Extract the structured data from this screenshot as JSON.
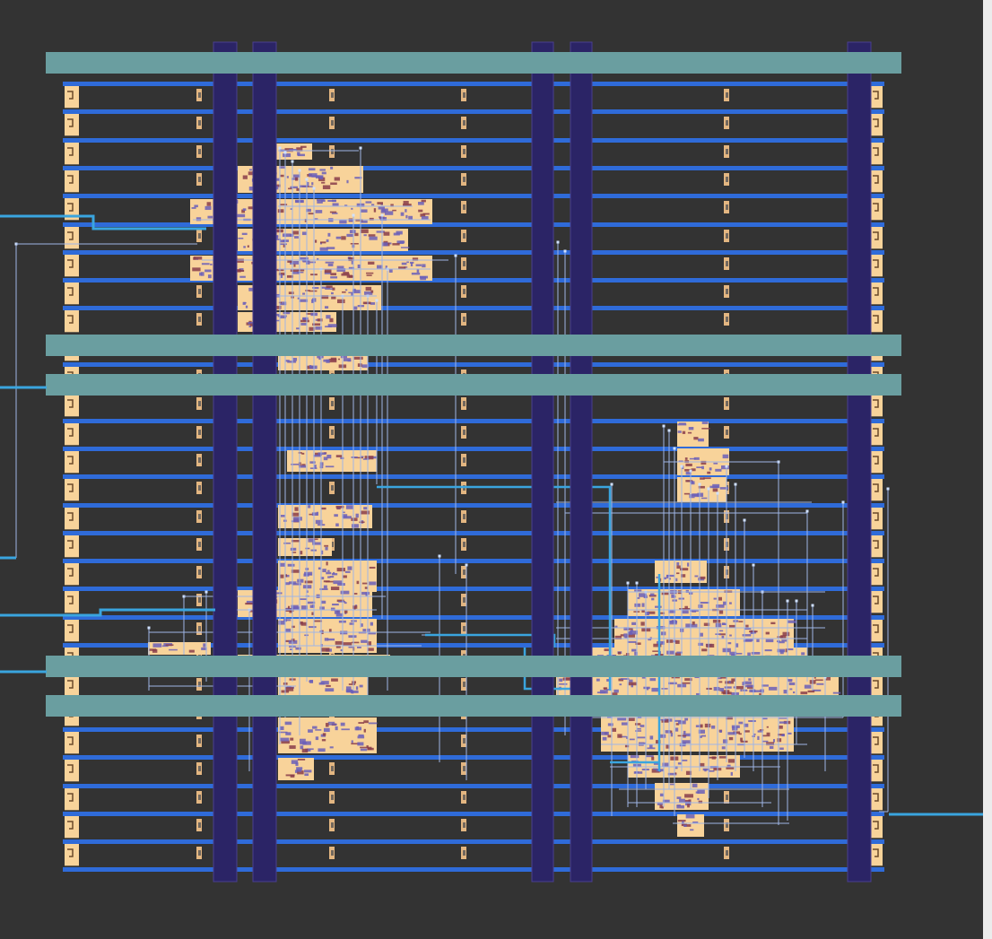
{
  "view": {
    "type": "chip-layout-viewer",
    "grid": "rows-and-columns"
  },
  "colors": {
    "background": "#333333",
    "scrollbar": "#ececec",
    "metal1_rail": "#2f6bd9",
    "metal_route": "#3aa5df",
    "thin_route": "#9fb6e6",
    "power_stripe_vertical": "#2b2466",
    "power_stripe_vertical_border": "#4a3f8f",
    "power_strap_horizontal": "#6a9ea0",
    "cell_fill": "#f8d39a",
    "cell_detail": "#6b5fb8",
    "tap_cell": "#f6c489"
  },
  "icons": {
    "scrollbar": "scrollbar-track"
  }
}
